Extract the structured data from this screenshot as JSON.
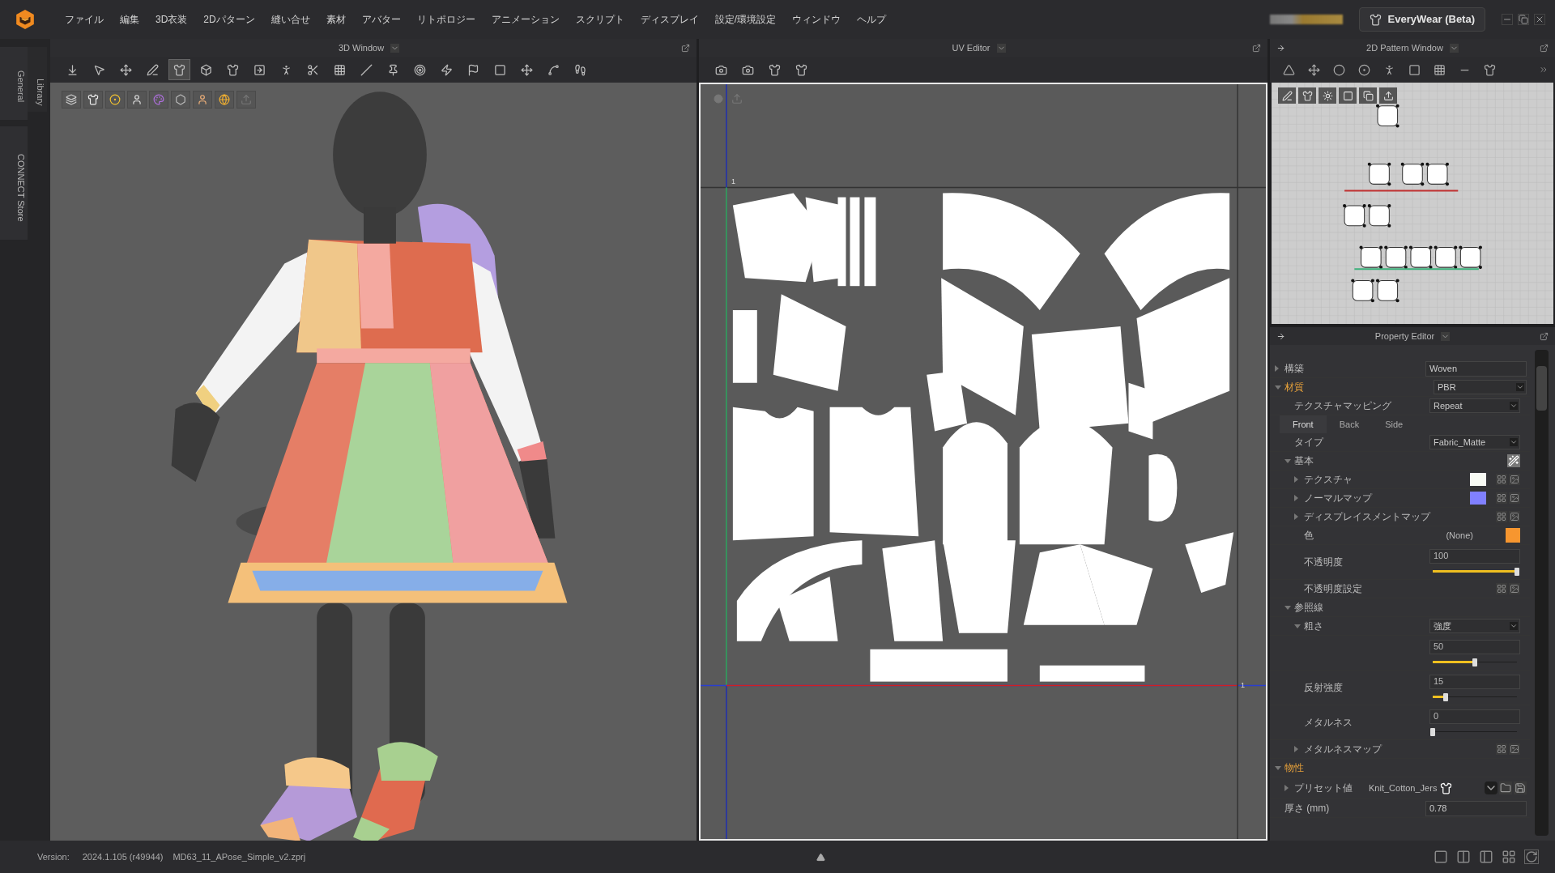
{
  "menu": [
    "ファイル",
    "編集",
    "3D衣装",
    "2Dパターン",
    "縫い合せ",
    "素材",
    "アバター",
    "リトポロジー",
    "アニメーション",
    "スクリプト",
    "ディスプレイ",
    "設定/環境設定",
    "ウィンドウ",
    "ヘルプ"
  ],
  "account_button": {
    "label": "EveryWear (Beta)"
  },
  "side_tabs": [
    "General",
    "Library",
    "CONNECT Store"
  ],
  "view3d": {
    "title": "3D Window"
  },
  "uv_editor": {
    "title": "UV Editor",
    "axis_labels": [
      "1",
      "1"
    ]
  },
  "pattern_2d": {
    "title": "2D Pattern Window"
  },
  "property_editor": {
    "title": "Property Editor",
    "rows": [
      {
        "kind": "field",
        "label": "構築",
        "value": "Woven",
        "expanded": false
      },
      {
        "kind": "section",
        "label": "材質",
        "value": "PBR",
        "expanded": true,
        "children": [
          {
            "kind": "dropdown",
            "label": "テクスチャマッピング",
            "value": "Repeat"
          },
          {
            "kind": "tabs",
            "tabs": [
              {
                "label": "Front",
                "selected": true
              },
              {
                "label": "Back",
                "selected": false
              },
              {
                "label": "Side",
                "selected": false
              }
            ]
          },
          {
            "kind": "dropdown",
            "label": "タイプ",
            "value": "Fabric_Matte"
          },
          {
            "kind": "group",
            "label": "基本",
            "expanded": true,
            "magic_button": true,
            "children": [
              {
                "kind": "map",
                "label": "テクスチャ",
                "expanded": false,
                "color": "#f8fbf4"
              },
              {
                "kind": "map",
                "label": "ノーマルマップ",
                "expanded": false,
                "color": "#8080ff"
              },
              {
                "kind": "map",
                "label": "ディスプレイスメントマップ",
                "expanded": false
              },
              {
                "kind": "color",
                "label": "色",
                "value": "(None)",
                "color": "#f7962f"
              },
              {
                "kind": "slider",
                "label": "不透明度",
                "value": "100",
                "level": 1
              },
              {
                "kind": "map",
                "label": "不透明度設定"
              }
            ]
          },
          {
            "kind": "group",
            "label": "参照線",
            "expanded": true,
            "children": [
              {
                "kind": "dropdown",
                "label": "粗さ",
                "value": "強度",
                "expanded": true,
                "children": [
                  {
                    "kind": "slider",
                    "value": "50",
                    "level": 0.5
                  }
                ]
              },
              {
                "kind": "slider",
                "label": "反射強度",
                "value": "15",
                "level": 0.15
              },
              {
                "kind": "slider",
                "label": "メタルネス",
                "value": "0",
                "level": 0
              },
              {
                "kind": "map",
                "label": "メタルネスマップ",
                "expanded": false
              }
            ]
          }
        ]
      },
      {
        "kind": "section",
        "label": "物性",
        "expanded": true,
        "children": [
          {
            "kind": "preset",
            "label": "プリセット値",
            "value": "Knit_Cotton_Jers",
            "expanded": false
          }
        ]
      },
      {
        "kind": "field",
        "label": "厚さ (mm)",
        "value": "0.78"
      }
    ]
  },
  "status_bar": {
    "version_label": "Version:",
    "version": "2024.1.105 (r49944)",
    "file": "MD63_11_APose_Simple_v2.zprj"
  }
}
